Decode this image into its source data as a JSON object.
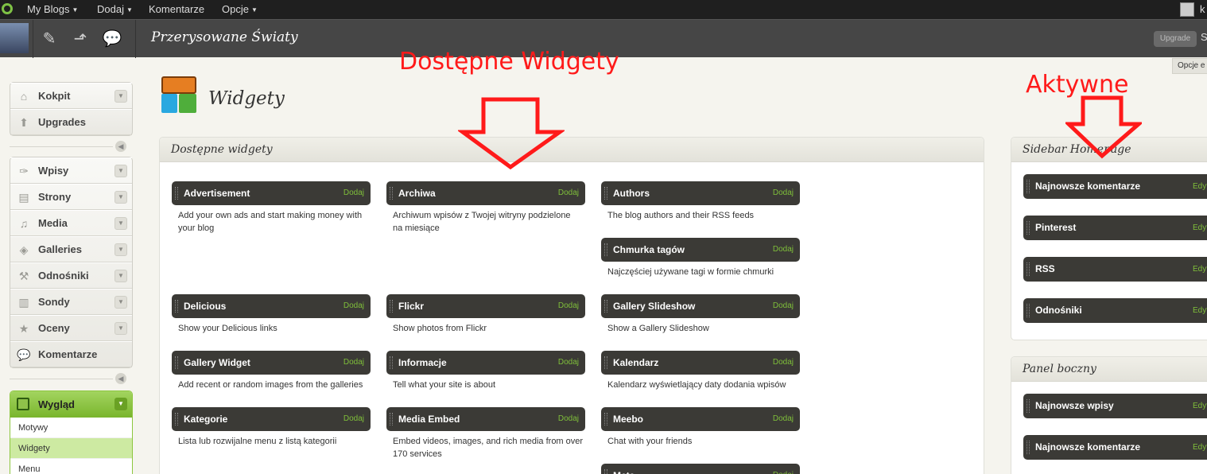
{
  "adminbar": {
    "menu": [
      {
        "label": "My Blogs",
        "dropdown": true
      },
      {
        "label": "Dodaj",
        "dropdown": true
      },
      {
        "label": "Komentarze",
        "dropdown": false
      },
      {
        "label": "Opcje",
        "dropdown": true
      }
    ],
    "user_initial": "k"
  },
  "blogbar": {
    "blog_title": "Przerysowane Światy",
    "upgrade_label": "Upgrade",
    "trailing_text": "S"
  },
  "screen_options_label": "Opcje e",
  "sidebar_menu": {
    "group1": [
      {
        "label": "Kokpit",
        "icon": "home-icon"
      },
      {
        "label": "Upgrades",
        "icon": "upgrade-arrow-icon"
      }
    ],
    "group2": [
      {
        "label": "Wpisy",
        "icon": "pushpin-icon"
      },
      {
        "label": "Strony",
        "icon": "pages-icon"
      },
      {
        "label": "Media",
        "icon": "camera-music-icon"
      },
      {
        "label": "Galleries",
        "icon": "galleries-icon"
      },
      {
        "label": "Odnośniki",
        "icon": "link-icon"
      },
      {
        "label": "Sondy",
        "icon": "polls-icon"
      },
      {
        "label": "Oceny",
        "icon": "stars-icon"
      },
      {
        "label": "Komentarze",
        "icon": "comment-bubble-icon"
      }
    ],
    "appearance": {
      "label": "Wygląd",
      "icon": "appearance-icon",
      "submenu": [
        "Motywy",
        "Widgety",
        "Menu"
      ],
      "active_submenu": "Widgety"
    }
  },
  "page": {
    "title": "Widgety"
  },
  "available_panel": {
    "title": "Dostępne widgety",
    "columns": [
      [
        {
          "name": "Advertisement",
          "action": "Dodaj",
          "desc": [
            "Add your own ads and start making money with",
            "your blog"
          ]
        },
        {
          "name": "Delicious",
          "action": "Dodaj",
          "desc": [
            "Show your Delicious links"
          ]
        },
        {
          "name": "Gallery Widget",
          "action": "Dodaj",
          "desc": [
            "Add recent or random images from the galleries"
          ]
        },
        {
          "name": "Kategorie",
          "action": "Dodaj",
          "desc": [
            "Lista lub rozwijalne menu z listą kategorii"
          ]
        }
      ],
      [
        {
          "name": "Archiwa",
          "action": "Dodaj",
          "desc": [
            "Archiwum wpisów z Twojej witryny podzielone",
            "na miesiące"
          ]
        },
        {
          "name": "Flickr",
          "action": "Dodaj",
          "desc": [
            "Show photos from Flickr"
          ]
        },
        {
          "name": "Informacje",
          "action": "Dodaj",
          "desc": [
            "Tell what your site is about"
          ]
        },
        {
          "name": "Media Embed",
          "action": "Dodaj",
          "desc": [
            "Embed videos, images, and rich media from over",
            "170 services"
          ]
        }
      ],
      [
        {
          "name": "Authors",
          "action": "Dodaj",
          "desc": [
            "The blog authors and their RSS feeds"
          ]
        },
        {
          "name": "Chmurka tagów",
          "action": "Dodaj",
          "desc": [
            "Najczęściej używane tagi w formie chmurki"
          ]
        },
        {
          "name": "Gallery Slideshow",
          "action": "Dodaj",
          "desc": [
            "Show a Gallery Slideshow"
          ]
        },
        {
          "name": "Kalendarz",
          "action": "Dodaj",
          "desc": [
            "Kalendarz wyświetlający daty dodania wpisów"
          ]
        },
        {
          "name": "Meebo",
          "action": "Dodaj",
          "desc": [
            "Chat with your friends"
          ]
        },
        {
          "name": "Meta",
          "action": "Dodaj",
          "desc": []
        }
      ]
    ]
  },
  "sidebar_areas": [
    {
      "title": "Sidebar Homepage",
      "widgets": [
        {
          "name": "Najnowsze komentarze",
          "action": "Edytuj"
        },
        {
          "name": "Pinterest",
          "action": "Edytuj"
        },
        {
          "name": "RSS",
          "action": "Edytuj"
        },
        {
          "name": "Odnośniki",
          "action": "Edytuj"
        }
      ]
    },
    {
      "title": "Panel boczny",
      "widgets": [
        {
          "name": "Najnowsze wpisy",
          "action": "Edytuj"
        },
        {
          "name": "Najnowsze komentarze",
          "action": "Edytuj"
        }
      ]
    }
  ],
  "annotations": {
    "available": "Dostępne Widgety",
    "active": "Aktywne",
    "color": "#ff1a1a"
  }
}
